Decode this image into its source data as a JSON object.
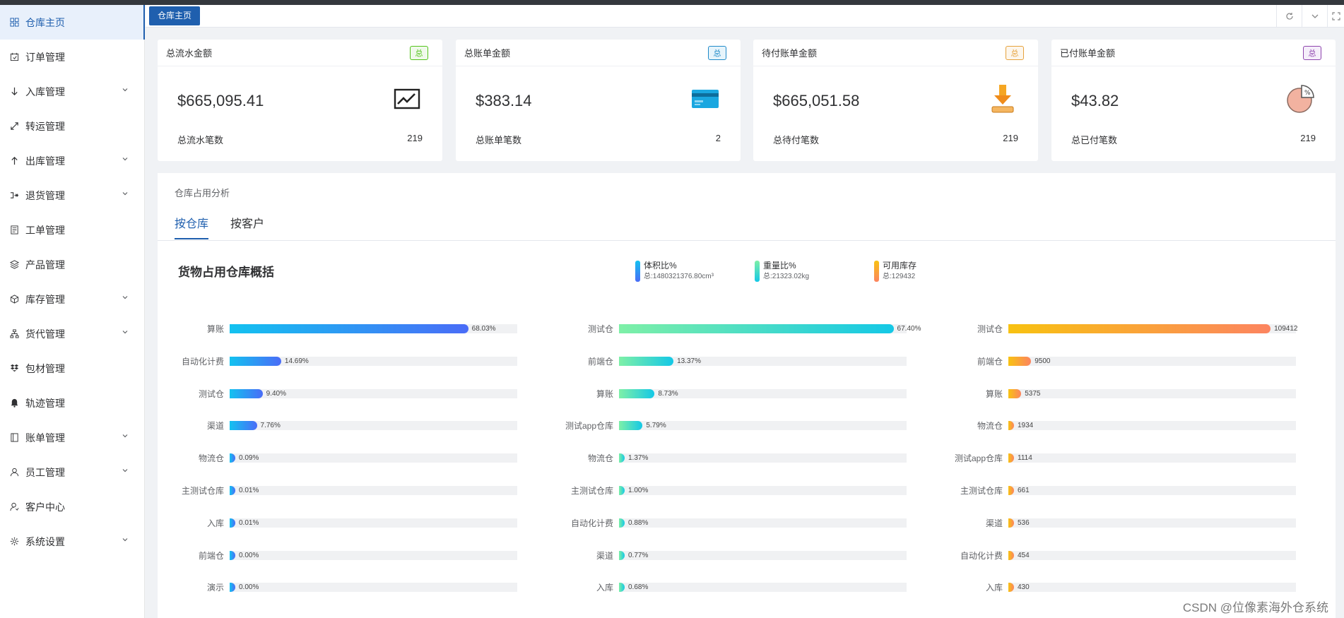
{
  "tabs": {
    "active": "仓库主页"
  },
  "sidebar": {
    "items": [
      {
        "label": "仓库主页",
        "icon": "grid-icon",
        "active": true,
        "expandable": false
      },
      {
        "label": "订单管理",
        "icon": "calendar-icon",
        "expandable": false
      },
      {
        "label": "入库管理",
        "icon": "arrow-down-icon",
        "expandable": true
      },
      {
        "label": "转运管理",
        "icon": "transfer-icon",
        "expandable": false
      },
      {
        "label": "出库管理",
        "icon": "arrow-up-icon",
        "expandable": true
      },
      {
        "label": "退货管理",
        "icon": "return-icon",
        "expandable": true
      },
      {
        "label": "工单管理",
        "icon": "document-icon",
        "expandable": false
      },
      {
        "label": "产品管理",
        "icon": "product-icon",
        "expandable": false
      },
      {
        "label": "库存管理",
        "icon": "box-icon",
        "expandable": true
      },
      {
        "label": "货代管理",
        "icon": "org-icon",
        "expandable": true
      },
      {
        "label": "包材管理",
        "icon": "dropbox-icon",
        "expandable": false
      },
      {
        "label": "轨迹管理",
        "icon": "bell-icon",
        "expandable": false
      },
      {
        "label": "账单管理",
        "icon": "bill-icon",
        "expandable": true
      },
      {
        "label": "员工管理",
        "icon": "user-icon",
        "expandable": true
      },
      {
        "label": "客户中心",
        "icon": "customer-icon",
        "expandable": false
      },
      {
        "label": "系统设置",
        "icon": "gear-icon",
        "expandable": true
      }
    ]
  },
  "cards": [
    {
      "title": "总流水金额",
      "badge": "总",
      "badge_color": "#52c41a",
      "badge_bg": "#f0f9eb",
      "amount": "$665,095.41",
      "icon": "line-chart-icon",
      "sub_label": "总流水笔数",
      "sub_count": "219"
    },
    {
      "title": "总账单金额",
      "badge": "总",
      "badge_color": "#1f8ac9",
      "badge_bg": "#e6f4fb",
      "amount": "$383.14",
      "icon": "credit-card-icon",
      "sub_label": "总账单笔数",
      "sub_count": "2"
    },
    {
      "title": "待付账单金额",
      "badge": "总",
      "badge_color": "#e6a23c",
      "badge_bg": "#fdf6ec",
      "amount": "$665,051.58",
      "icon": "download-tray-icon",
      "sub_label": "总待付笔数",
      "sub_count": "219"
    },
    {
      "title": "已付账单金额",
      "badge": "总",
      "badge_color": "#8e44ad",
      "badge_bg": "#f5eefa",
      "amount": "$43.82",
      "icon": "pie-percent-icon",
      "sub_label": "总已付笔数",
      "sub_count": "219"
    }
  ],
  "panel": {
    "title": "仓库占用分析",
    "tabs": [
      "按仓库",
      "按客户"
    ],
    "active_tab": "按仓库",
    "section_title": "货物占用仓库概括"
  },
  "legend": [
    {
      "label": "体积比%",
      "sub": "总:1480321376.80cm³",
      "colors": [
        "#13c2f0",
        "#4a6cf7"
      ]
    },
    {
      "label": "重量比%",
      "sub": "总:21323.02kg",
      "colors": [
        "#7ef0a7",
        "#14c8e6"
      ]
    },
    {
      "label": "可用库存",
      "sub": "总:129432",
      "colors": [
        "#f8c211",
        "#fc8460"
      ]
    }
  ],
  "chart_data": [
    {
      "type": "bar",
      "title": "体积比%",
      "categories": [
        "算账",
        "自动化计费",
        "测试仓",
        "渠道",
        "物流仓",
        "主测试仓库",
        "入库",
        "前端仓",
        "演示"
      ],
      "values": [
        68.03,
        14.69,
        9.4,
        7.76,
        0.09,
        0.01,
        0.01,
        0.0,
        0.0
      ],
      "labels": [
        "68.03%",
        "14.69%",
        "9.40%",
        "7.76%",
        "0.09%",
        "0.01%",
        "0.01%",
        "0.00%",
        "0.00%"
      ],
      "xlim": [
        0,
        82
      ]
    },
    {
      "type": "bar",
      "title": "重量比%",
      "categories": [
        "测试仓",
        "前端仓",
        "算账",
        "测试app仓库",
        "物流仓",
        "主测试仓库",
        "自动化计费",
        "渠道",
        "入库"
      ],
      "values": [
        67.4,
        13.37,
        8.73,
        5.79,
        1.37,
        1.0,
        0.88,
        0.77,
        0.68
      ],
      "labels": [
        "67.40%",
        "13.37%",
        "8.73%",
        "5.79%",
        "1.37%",
        "1.00%",
        "0.88%",
        "0.77%",
        "0.68%"
      ],
      "xlim": [
        0,
        70.6
      ]
    },
    {
      "type": "bar",
      "title": "可用库存",
      "categories": [
        "测试仓",
        "前端仓",
        "算账",
        "物流仓",
        "测试app仓库",
        "主测试仓库",
        "渠道",
        "自动化计费",
        "入库"
      ],
      "values": [
        109412,
        9500,
        5375,
        1934,
        1114,
        661,
        536,
        454,
        430
      ],
      "labels": [
        "109412",
        "9500",
        "5375",
        "1934",
        "1114",
        "661",
        "536",
        "454",
        "430"
      ],
      "xlim": [
        0,
        120000
      ]
    }
  ],
  "watermark": "CSDN @位像素海外仓系统"
}
